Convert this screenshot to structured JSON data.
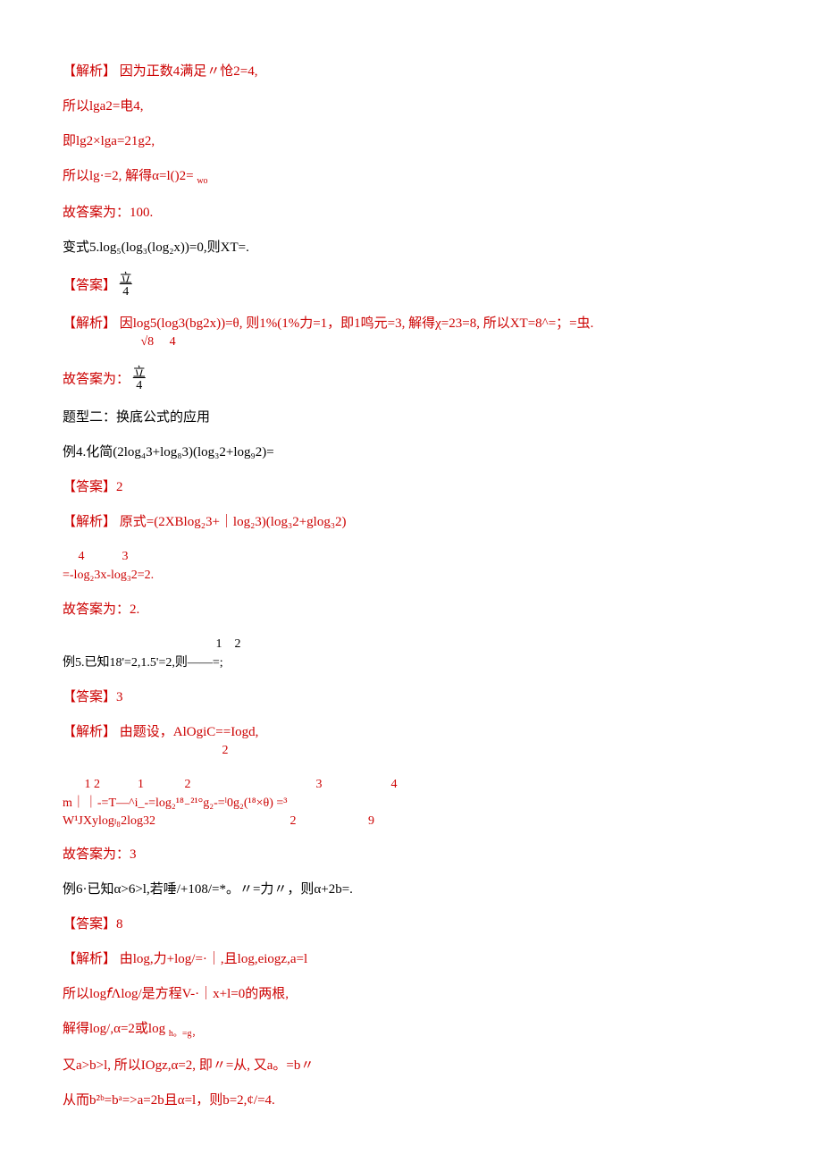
{
  "p01_a": "【解析】",
  "p01_b": "因为正数4满足〃怆2=4,",
  "p02": "所以lga2=电4,",
  "p03": "即lg2×lga=21g2,",
  "p04_a": "所以lg·=2,",
  "p04_b": "解得α=l()2=",
  "p04_c": "wo",
  "p05": "故答案为：100.",
  "p06": "变式5.log₅(log₃(log₂x))=0,则XT=.",
  "p07_a": "【答案】",
  "p07_b_top": "立",
  "p07_b_bot": "4",
  "p08_a": "【解析】",
  "p08_b": "因log5(log3(bg2x))=θ,",
  "p08_c": "则1%(1%力=1，即1鸣元=3,",
  "p08_d": "解得χ=23=8,",
  "p08_e": "所以XT=8^=；=虫.",
  "p08_denoms": "                         √8     4",
  "p09_a": "故答案为：",
  "p09_b_top": "立",
  "p09_b_bot": "4",
  "p10": "题型二：换底公式的应用",
  "p11": "例4.化简(2log₄3+log₈3)(log₃2+log₉2)=",
  "p12": "【答案】2",
  "p13_a": "【解析】",
  "p13_b": "原式=(2XBlog₂3+｜log₂3)(log₃2+glog₃2)",
  "p14_nums": "     4            3",
  "p14": "=-log₂3x-log₃2=2.",
  "p15": "故答案为：2.",
  "p16_nums": "                                                 1    2",
  "p16": "例5.已知18'=2,1.5'=2,则——=;",
  "p17": "【答案】3",
  "p18_a": "【解析】",
  "p18_b": "由题设，AlOgiC==Iogd,",
  "p18_c": "                                                   2",
  "p19_nums": "       1 2            1             2                                        3                      4",
  "p19_a": "m｜｜-=T—^i_-=log₂¹⁸₋²¹°g₂-=ˡ0g₂(¹⁸×θ) =³",
  "p19_b": "W¹JXylogₗ₈2log32                                           2                       9",
  "p20": "故答案为：3",
  "p21": "例6·已知α>6>l,若唾/+108/=*。〃=力〃，则α+2b=.",
  "p22": "【答案】8",
  "p23_a": "【解析】",
  "p23_b": "由log,力+log/=·｜,且log,eiogz,a=l",
  "p24": "所以log𝘧Λlog/是方程V-·｜x+l=0的两根,",
  "p25_a": "解得log/,α=2或log",
  "p25_b": "h。=g，",
  "p26_a": "又a>b>l,",
  "p26_b": "所以IOgz,α=2,",
  "p26_c": "即〃=从, 又a。=b〃",
  "p27_a": "从而b²ᵇ=bᵃ=>a=2b且α=l，则b=2,¢/=4.",
  "p27_b": ""
}
